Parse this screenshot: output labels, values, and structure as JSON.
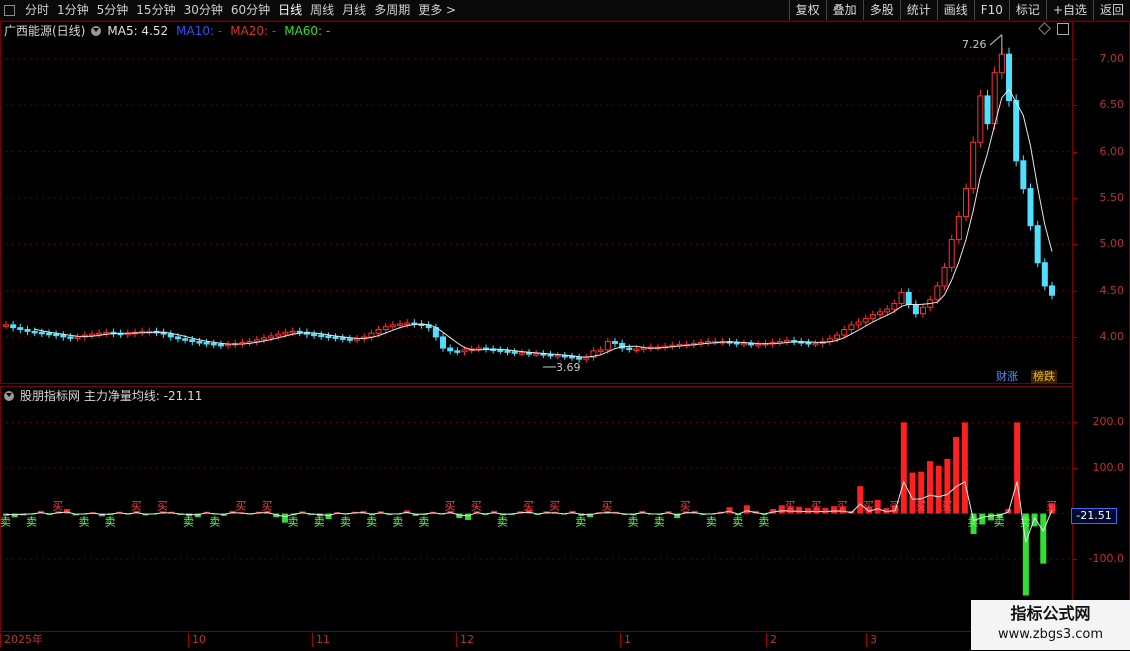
{
  "toolbar": {
    "periods": [
      "分时",
      "1分钟",
      "5分钟",
      "15分钟",
      "30分钟",
      "60分钟",
      "日线",
      "周线",
      "月线",
      "多周期",
      "更多 >"
    ],
    "active_period": "日线",
    "right_buttons": [
      "复权",
      "叠加",
      "多股",
      "统计",
      "画线",
      "F10",
      "标记",
      "+自选",
      "返回"
    ]
  },
  "main_pane": {
    "stock_title": "广西能源(日线)",
    "ma_items": [
      {
        "label": "MA5: 4.52",
        "color": "#e0e0e0"
      },
      {
        "label": "MA10: -",
        "color": "#3050ff"
      },
      {
        "label": "MA20: -",
        "color": "#e03030"
      },
      {
        "label": "MA60: -",
        "color": "#30e030"
      }
    ],
    "price_axis": [
      "7.00",
      "6.50",
      "6.00",
      "5.50",
      "5.00",
      "4.50",
      "4.00"
    ],
    "high_label": "7.26",
    "low_label": "3.69",
    "tags": {
      "caizhang": "财涨",
      "bangdie": "榜跌"
    }
  },
  "indicator_pane": {
    "title": "股朋指标网 主力净量均线: -21.11",
    "axis": [
      "200.0",
      "100.0",
      "-100.0"
    ],
    "current_value": "-21.51",
    "buy_label": "买",
    "sell_label": "卖"
  },
  "date_axis": [
    "2025年",
    "10",
    "11",
    "12",
    "1",
    "2",
    "3"
  ],
  "watermark": {
    "line1": "指标公式网",
    "line2": "www.zbgs3.com"
  },
  "chart_data": {
    "type": "candlestick",
    "title": "广西能源(日线)",
    "price_range": [
      3.6,
      7.3
    ],
    "high": 7.26,
    "low": 3.69,
    "closes": [
      4.13,
      4.1,
      4.08,
      4.06,
      4.05,
      4.04,
      4.03,
      4.02,
      4.0,
      3.99,
      4.0,
      4.02,
      4.03,
      4.04,
      4.05,
      4.04,
      4.03,
      4.04,
      4.05,
      4.06,
      4.06,
      4.05,
      4.03,
      4.0,
      3.98,
      3.97,
      3.95,
      3.94,
      3.93,
      3.92,
      3.91,
      3.92,
      3.93,
      3.94,
      3.95,
      3.97,
      3.99,
      4.01,
      4.03,
      4.05,
      4.06,
      4.05,
      4.03,
      4.02,
      4.01,
      4.0,
      3.99,
      3.98,
      3.97,
      3.98,
      4.0,
      4.04,
      4.08,
      4.11,
      4.13,
      4.14,
      4.15,
      4.14,
      4.13,
      4.1,
      4.0,
      3.88,
      3.85,
      3.84,
      3.86,
      3.87,
      3.88,
      3.87,
      3.86,
      3.85,
      3.84,
      3.83,
      3.83,
      3.82,
      3.82,
      3.81,
      3.8,
      3.8,
      3.79,
      3.78,
      3.76,
      3.78,
      3.85,
      3.86,
      3.95,
      3.93,
      3.88,
      3.87,
      3.87,
      3.88,
      3.89,
      3.89,
      3.9,
      3.91,
      3.92,
      3.92,
      3.93,
      3.94,
      3.95,
      3.95,
      3.95,
      3.94,
      3.93,
      3.93,
      3.92,
      3.92,
      3.93,
      3.94,
      3.95,
      3.96,
      3.95,
      3.94,
      3.93,
      3.93,
      3.95,
      3.98,
      4.02,
      4.08,
      4.13,
      4.16,
      4.2,
      4.24,
      4.27,
      4.3,
      4.36,
      4.48,
      4.35,
      4.25,
      4.32,
      4.4,
      4.55,
      4.75,
      5.05,
      5.3,
      5.6,
      6.1,
      6.6,
      6.3,
      6.85,
      7.05,
      6.55,
      5.9,
      5.6,
      5.2,
      4.8,
      4.55,
      4.45
    ],
    "indicator_values": [
      -5,
      -8,
      -4,
      -2,
      6,
      -3,
      5,
      10,
      -4,
      -2,
      3,
      -6,
      -3,
      4,
      -2,
      6,
      -4,
      -2,
      5,
      4,
      -3,
      -6,
      -8,
      4,
      -2,
      -5,
      6,
      3,
      -2,
      4,
      6,
      -8,
      -20,
      -4,
      5,
      -3,
      -6,
      -12,
      3,
      -2,
      4,
      6,
      -4,
      5,
      -3,
      -2,
      7,
      -5,
      -3,
      4,
      -2,
      6,
      -10,
      -14,
      5,
      -3,
      6,
      -4,
      -3,
      5,
      8,
      -3,
      5,
      4,
      -2,
      6,
      -5,
      -8,
      3,
      6,
      4,
      -3,
      -4,
      6,
      -2,
      -3,
      5,
      -10,
      5,
      6,
      -3,
      -2,
      4,
      14,
      -4,
      18,
      6,
      -3,
      10,
      18,
      14,
      15,
      12,
      13,
      12,
      16,
      14,
      6,
      60,
      14,
      30,
      12,
      18,
      200,
      90,
      92,
      115,
      105,
      120,
      168,
      200,
      -45,
      -24,
      -15,
      -10,
      10,
      200,
      -180,
      -28,
      -110,
      22
    ]
  }
}
